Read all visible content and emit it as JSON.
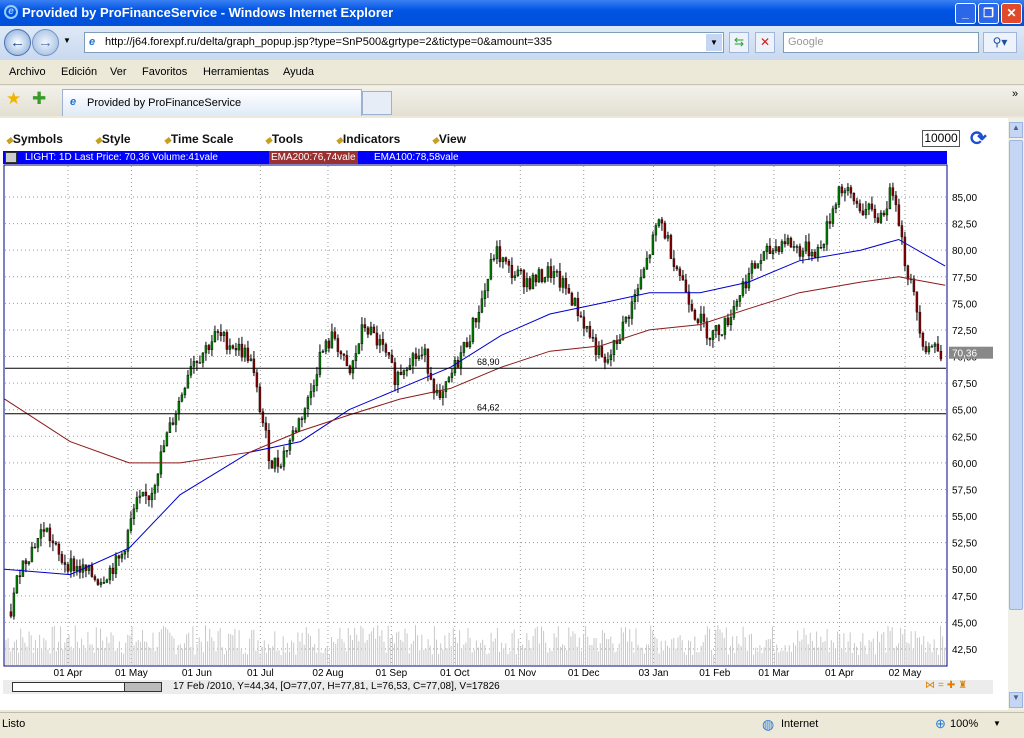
{
  "window": {
    "title": "Provided by ProFinanceService - Windows Internet Explorer"
  },
  "nav": {
    "url": "http://j64.forexpf.ru/delta/graph_popup.jsp?type=SnP500&grtype=2&tictype=0&amount=335",
    "search_placeholder": "Google"
  },
  "menu": [
    "Archivo",
    "Edición",
    "Ver",
    "Favoritos",
    "Herramientas",
    "Ayuda"
  ],
  "tab": {
    "label": "Provided by ProFinanceService"
  },
  "chart_toolbar": {
    "items": [
      "Symbols",
      "Style",
      "Time Scale",
      "Tools",
      "Indicators",
      "View"
    ],
    "amount": "10000"
  },
  "legend": {
    "main": "LIGHT: 1D Last Price: 70,36 Volume:41vale",
    "ema200": "EMA200:76,74vale",
    "ema100": "EMA100:78,58vale"
  },
  "status_line": "17 Feb /2010, Y=44,34, [O=77,07, H=77,81, L=76,53, C=77,08], V=17826",
  "statusbar": {
    "text": "Listo",
    "zone": "Internet",
    "zoom": "100%"
  },
  "colors": {
    "ema200": "#8b1a1a",
    "ema100": "#0000cc",
    "up": "#008000",
    "down": "#8b0000",
    "legend_bg": "#0000ff"
  },
  "chart_data": {
    "type": "candlestick",
    "x_tick_labels": [
      "01 Apr",
      "01 May",
      "01 Jun",
      "01 Jul",
      "02 Aug",
      "01 Sep",
      "01 Oct",
      "01 Nov",
      "01 Dec",
      "03 Jan",
      "01 Feb",
      "01 Mar",
      "01 Apr",
      "02 May"
    ],
    "y_tick_labels": [
      "42,50",
      "45,00",
      "47,50",
      "50,00",
      "52,50",
      "55,00",
      "57,50",
      "60,00",
      "62,50",
      "65,00",
      "67,50",
      "70,00",
      "72,50",
      "75,00",
      "77,50",
      "80,00",
      "82,50",
      "85,00"
    ],
    "ylim": [
      41.6,
      87.6
    ],
    "last_price": "70,36",
    "hlines": [
      {
        "value": 68.9,
        "label": "68,90"
      },
      {
        "value": 64.62,
        "label": "64,62"
      }
    ],
    "close": [
      [
        "2009-03-05",
        46
      ],
      [
        "2009-03-09",
        50
      ],
      [
        "2009-03-21",
        54
      ],
      [
        "2009-03-28",
        51
      ],
      [
        "2009-04-07",
        50
      ],
      [
        "2009-04-16",
        49
      ],
      [
        "2009-04-26",
        51
      ],
      [
        "2009-05-03",
        56
      ],
      [
        "2009-05-10",
        57
      ],
      [
        "2009-05-17",
        62
      ],
      [
        "2009-05-24",
        66
      ],
      [
        "2009-05-29",
        69.5
      ],
      [
        "2009-06-02",
        70
      ],
      [
        "2009-06-10",
        72
      ],
      [
        "2009-06-19",
        71
      ],
      [
        "2009-06-26",
        70
      ],
      [
        "2009-07-01",
        65
      ],
      [
        "2009-07-06",
        60
      ],
      [
        "2009-07-10",
        60
      ],
      [
        "2009-07-17",
        63
      ],
      [
        "2009-07-24",
        66
      ],
      [
        "2009-07-29",
        70
      ],
      [
        "2009-08-05",
        72
      ],
      [
        "2009-08-12",
        68
      ],
      [
        "2009-08-19",
        73
      ],
      [
        "2009-08-27",
        71
      ],
      [
        "2009-09-03",
        68
      ],
      [
        "2009-09-10",
        70
      ],
      [
        "2009-09-17",
        70
      ],
      [
        "2009-09-24",
        65.5
      ],
      [
        "2009-10-01",
        69
      ],
      [
        "2009-10-08",
        72
      ],
      [
        "2009-10-15",
        76
      ],
      [
        "2009-10-20",
        80
      ],
      [
        "2009-10-27",
        78
      ],
      [
        "2009-11-06",
        77
      ],
      [
        "2009-11-15",
        78
      ],
      [
        "2009-11-24",
        76
      ],
      [
        "2009-12-04",
        72
      ],
      [
        "2009-12-11",
        69
      ],
      [
        "2009-12-18",
        72
      ],
      [
        "2009-12-28",
        77
      ],
      [
        "2010-01-06",
        83
      ],
      [
        "2010-01-13",
        79
      ],
      [
        "2010-01-23",
        74
      ],
      [
        "2010-01-30",
        72
      ],
      [
        "2010-02-06",
        73
      ],
      [
        "2010-02-15",
        77
      ],
      [
        "2010-02-22",
        79
      ],
      [
        "2010-03-06",
        81
      ],
      [
        "2010-03-13",
        80
      ],
      [
        "2010-03-23",
        80
      ],
      [
        "2010-04-01",
        86
      ],
      [
        "2010-04-11",
        84
      ],
      [
        "2010-04-20",
        83
      ],
      [
        "2010-04-27",
        86
      ],
      [
        "2010-05-02",
        79
      ],
      [
        "2010-05-07",
        75
      ],
      [
        "2010-05-11",
        71
      ],
      [
        "2010-05-16",
        71
      ],
      [
        "2010-05-20",
        70.36
      ]
    ],
    "series": [
      {
        "name": "EMA100",
        "values": [
          [
            "2009-03-02",
            50
          ],
          [
            "2009-04-02",
            49.5
          ],
          [
            "2009-04-30",
            52
          ],
          [
            "2009-05-24",
            57
          ],
          [
            "2009-06-26",
            61
          ],
          [
            "2009-07-20",
            62
          ],
          [
            "2009-08-12",
            65
          ],
          [
            "2009-09-05",
            67
          ],
          [
            "2009-09-29",
            69
          ],
          [
            "2009-10-23",
            72
          ],
          [
            "2009-11-15",
            74
          ],
          [
            "2009-12-09",
            75
          ],
          [
            "2010-01-01",
            76
          ],
          [
            "2010-01-25",
            76
          ],
          [
            "2010-02-17",
            77
          ],
          [
            "2010-03-13",
            79
          ],
          [
            "2010-04-11",
            80
          ],
          [
            "2010-04-29",
            81
          ],
          [
            "2010-05-21",
            78.5
          ]
        ]
      },
      {
        "name": "EMA200",
        "values": [
          [
            "2009-03-02",
            66
          ],
          [
            "2009-04-02",
            62
          ],
          [
            "2009-04-30",
            60
          ],
          [
            "2009-05-24",
            60
          ],
          [
            "2009-06-26",
            61
          ],
          [
            "2009-07-20",
            63
          ],
          [
            "2009-08-12",
            64.5
          ],
          [
            "2009-09-05",
            66
          ],
          [
            "2009-09-29",
            67
          ],
          [
            "2009-10-23",
            69
          ],
          [
            "2009-11-15",
            70.5
          ],
          [
            "2009-12-09",
            71
          ],
          [
            "2010-01-01",
            72.5
          ],
          [
            "2010-01-25",
            73
          ],
          [
            "2010-02-17",
            74.5
          ],
          [
            "2010-03-13",
            76
          ],
          [
            "2010-04-11",
            77
          ],
          [
            "2010-04-29",
            77.5
          ],
          [
            "2010-05-21",
            76.7
          ]
        ]
      }
    ]
  }
}
